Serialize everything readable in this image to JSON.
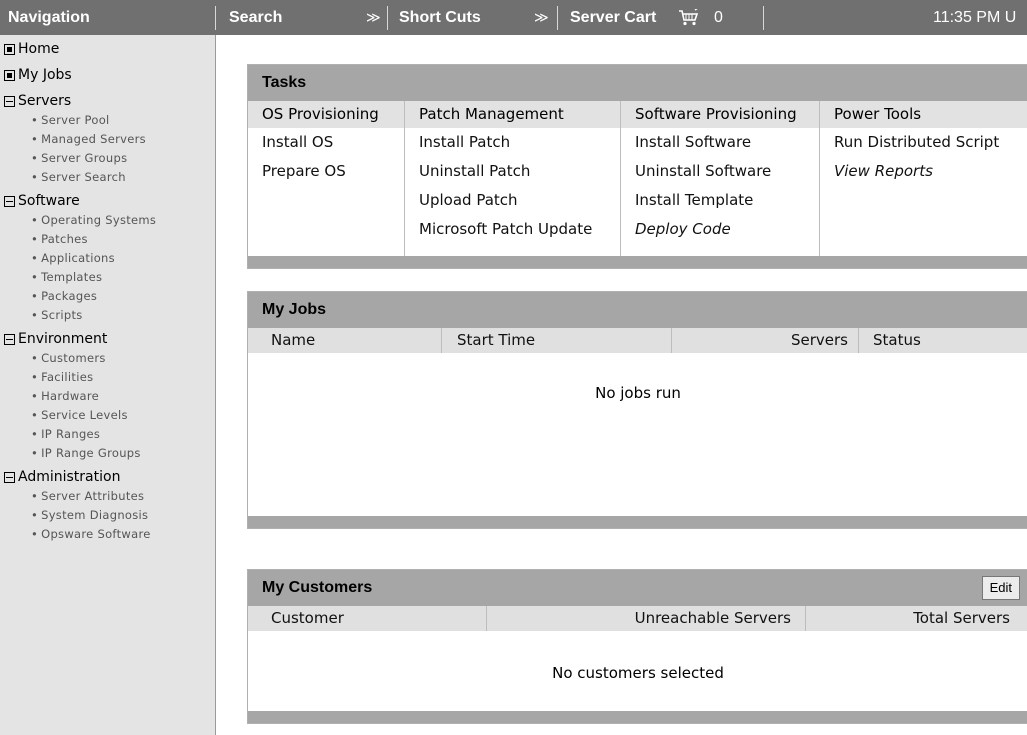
{
  "topbar": {
    "navigation": "Navigation",
    "search": "Search",
    "search_chevron": "≫",
    "shortcuts": "Short Cuts",
    "shortcuts_chevron": "≫",
    "server_cart": "Server Cart",
    "cart_icon": "shopping-cart-icon",
    "cart_count": "0",
    "time": "11:35 PM U"
  },
  "sidebar": {
    "home": "Home",
    "my_jobs": "My Jobs",
    "groups": [
      {
        "label": "Servers",
        "items": [
          "Server Pool",
          "Managed Servers",
          "Server Groups",
          "Server Search"
        ]
      },
      {
        "label": "Software",
        "items": [
          "Operating Systems",
          "Patches",
          "Applications",
          "Templates",
          "Packages",
          "Scripts"
        ]
      },
      {
        "label": "Environment",
        "items": [
          "Customers",
          "Facilities",
          "Hardware",
          "Service Levels",
          "IP Ranges",
          "IP Range Groups"
        ]
      },
      {
        "label": "Administration",
        "items": [
          "Server Attributes",
          "System Diagnosis",
          "Opsware Software"
        ]
      }
    ]
  },
  "tasks": {
    "title": "Tasks",
    "columns": [
      {
        "header": "OS Provisioning",
        "links": [
          "Install OS",
          "Prepare OS"
        ]
      },
      {
        "header": "Patch Management",
        "links": [
          "Install Patch",
          "Uninstall Patch",
          "Upload Patch",
          "Microsoft Patch Update"
        ]
      },
      {
        "header": "Software Provisioning",
        "links": [
          "Install Software",
          "Uninstall Software",
          "Install Template",
          "Deploy Code"
        ]
      },
      {
        "header": "Power Tools",
        "links": [
          "Run Distributed Script",
          "View Reports"
        ]
      }
    ]
  },
  "my_jobs": {
    "title": "My Jobs",
    "columns": [
      "Name",
      "Start Time",
      "Servers",
      "Status"
    ],
    "empty_text": "No jobs run"
  },
  "my_customers": {
    "title": "My Customers",
    "edit_label": "Edit",
    "columns": [
      "Customer",
      "Unreachable Servers",
      "Total Servers"
    ],
    "empty_text": "No customers selected"
  }
}
